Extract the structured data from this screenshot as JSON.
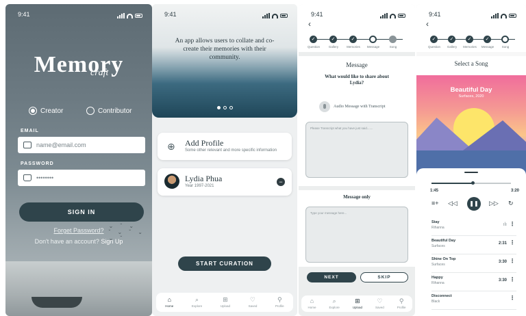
{
  "status": {
    "time": "9:41"
  },
  "login": {
    "logo": "Memory",
    "logo_sub": "craft",
    "role_creator": "Creator",
    "role_contributor": "Contributor",
    "email_label": "EMAIL",
    "email_placeholder": "name@email.com",
    "password_label": "PASSWORD",
    "password_value": "••••••••",
    "signin": "SIGN IN",
    "forgot": "Forget Password?",
    "no_account": "Don't have an account?",
    "signup": "Sign Up"
  },
  "home": {
    "tagline": "An app allows users to collate and co-create their memories with their community.",
    "add_profile_title": "Add Profile",
    "add_profile_sub": "Some other relevant and more specific information",
    "profile_name": "Lydia Phua",
    "profile_years": "Year 1997-2021",
    "start": "START CURATION",
    "tabs": [
      "Home",
      "Explore",
      "Upload",
      "Saved",
      "Profile"
    ]
  },
  "message": {
    "steps": [
      "Question",
      "Gallery",
      "Memories",
      "Message",
      "Song"
    ],
    "title": "Message",
    "prompt": "What would like to share about Lydia?",
    "audio": "Audio Message with Transcript",
    "transcript_placeholder": "Please Transcript what you have just said.......",
    "message_only": "Message only",
    "message_placeholder": "Type your message here...",
    "next": "NEXT",
    "skip": "SKIP"
  },
  "song": {
    "title": "Select a Song",
    "art_title": "Beautiful Day",
    "art_sub": "Surfaces, 2020",
    "time_elapsed": "1:45",
    "time_total": "3:20",
    "progress": 0.52,
    "tracks": [
      {
        "name": "Stay",
        "artist": "Rihanna",
        "duration": ""
      },
      {
        "name": "Beautiful Day",
        "artist": "Surfaces",
        "duration": "2:31"
      },
      {
        "name": "Shine On Top",
        "artist": "Surfaces",
        "duration": "3:30"
      },
      {
        "name": "Happy",
        "artist": "Rihanna",
        "duration": "3:30"
      },
      {
        "name": "Disconnect",
        "artist": "Black",
        "duration": ""
      }
    ]
  },
  "colors": {
    "primary": "#2f444b",
    "background": "#eef0f1"
  }
}
